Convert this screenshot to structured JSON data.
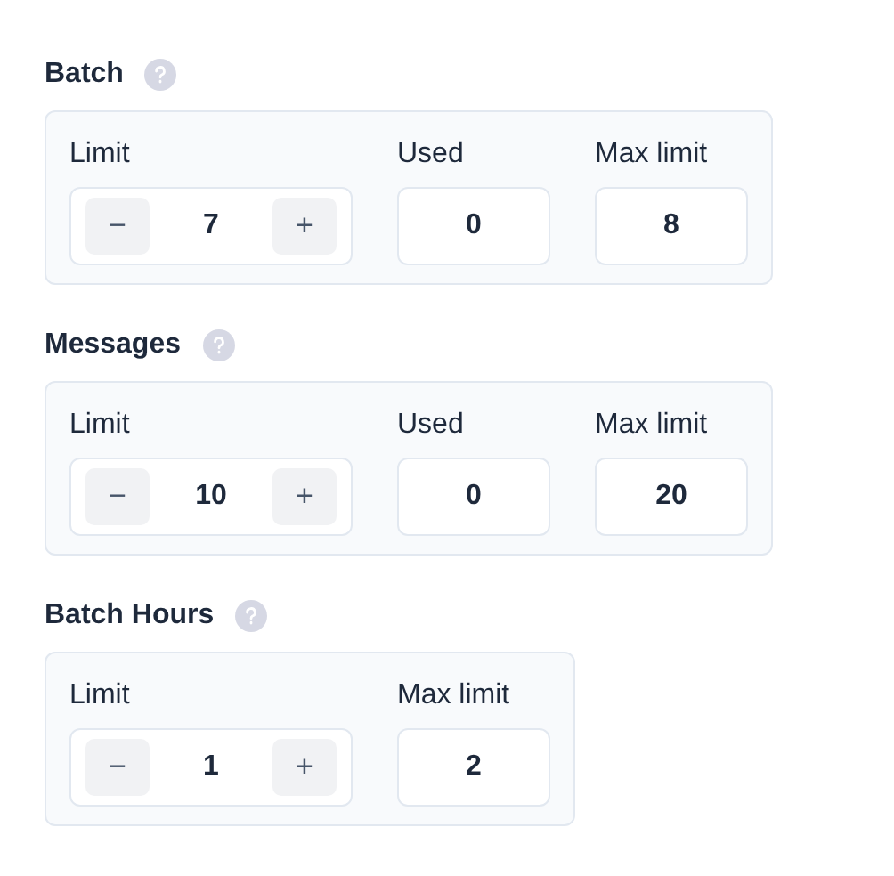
{
  "sections": [
    {
      "title": "Batch",
      "fields": [
        {
          "kind": "stepper",
          "label": "Limit",
          "value": "7",
          "decrement": "−",
          "increment": "+"
        },
        {
          "kind": "readonly",
          "label": "Used",
          "value": "0"
        },
        {
          "kind": "readonly",
          "label": "Max limit",
          "value": "8"
        }
      ]
    },
    {
      "title": "Messages",
      "fields": [
        {
          "kind": "stepper",
          "label": "Limit",
          "value": "10",
          "decrement": "−",
          "increment": "+"
        },
        {
          "kind": "readonly",
          "label": "Used",
          "value": "0"
        },
        {
          "kind": "readonly",
          "label": "Max limit",
          "value": "20"
        }
      ]
    },
    {
      "title": "Batch Hours",
      "fields": [
        {
          "kind": "stepper",
          "label": "Limit",
          "value": "1",
          "decrement": "−",
          "increment": "+"
        },
        {
          "kind": "readonly",
          "label": "Max limit",
          "value": "2"
        }
      ]
    }
  ]
}
